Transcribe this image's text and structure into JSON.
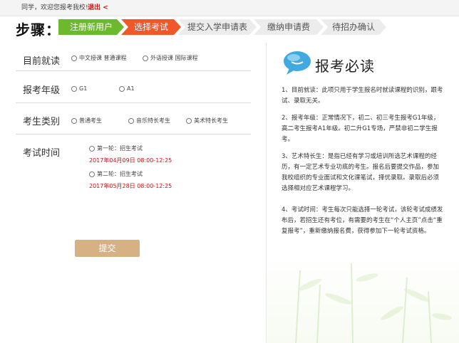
{
  "topbar": {
    "greeting": "同学，欢迎您报考我校!",
    "logout": "退出 <"
  },
  "steps": {
    "title": "步骤：",
    "items": [
      "注册新用户",
      "选择考试",
      "提交入学申请表",
      "缴纳申请费",
      "待招办确认"
    ]
  },
  "form": {
    "course": {
      "label": "目前就读",
      "options": [
        "中文授课 普通课程",
        "外语授课 国际课程"
      ]
    },
    "grade": {
      "label": "报考年级",
      "options": [
        "G1",
        "A1"
      ]
    },
    "category": {
      "label": "考生类别",
      "options": [
        "普通考生",
        "音乐特长考生",
        "美术特长考生"
      ]
    },
    "exam": {
      "label": "考试时间",
      "rounds": [
        {
          "name": "第一轮：招生考试",
          "time": "2017年04月09日   08:00-12:25"
        },
        {
          "name": "第二轮：招生考试",
          "time": "2017年05月28日   08:00-12:25"
        }
      ]
    },
    "submit": "提交"
  },
  "notice": {
    "title": "报考必读",
    "items": [
      "1、目前就读：此项只用于学生报名时就读课程的识别，跟考试、录取无关。",
      "2、报考年级：正常情况下，初二、初三考生报考G1年级，高二考生报考A1年级。初二升G1专场，严禁非初二学生报考。",
      "3、艺术特长生：是指已经有学习或培训所选艺术课程的经历，有一定艺术专业功底的考生。报名后要提交作品，参加我校组织的专业面试和文化课笔试，择优录取。录取后必须选择相对应艺术课程学习。",
      "4、考试时间：考生每次只能选择一轮考试，该轮考试成绩发布后，若招生还有考位，有需要的考生在“个人主页”点击“重复报考”，重新缴纳报名费，获得参加下一轮考试资格。"
    ]
  },
  "colors": {
    "step_done": "#6cb92e",
    "step_active": "#f0582a",
    "exam_time": "#d01010",
    "submit_bg": "#d5b184"
  }
}
